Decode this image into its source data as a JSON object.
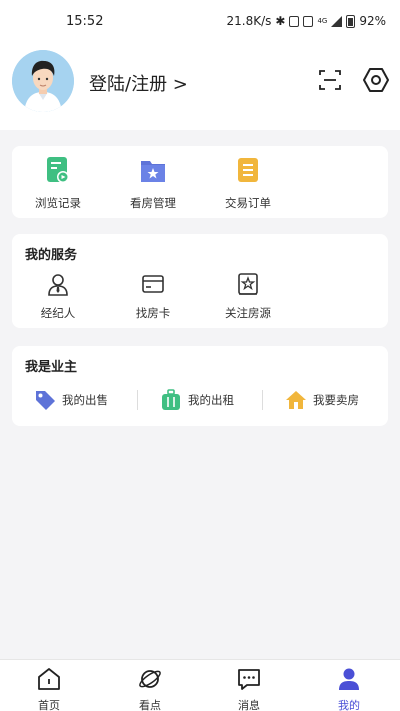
{
  "status_bar": {
    "time": "15:52",
    "network_speed": "21.8K/s",
    "battery": "92%",
    "icons": [
      "bluetooth-icon",
      "vibrate-icon",
      "nfc-icon",
      "4g-icon",
      "signal-icon",
      "battery-icon"
    ]
  },
  "header": {
    "login_label": "登陆/注册 >",
    "icons": [
      "scan-icon",
      "settings-icon"
    ]
  },
  "quick_actions": [
    {
      "label": "浏览记录",
      "icon": "browse-history-icon",
      "color": "#3fbf82"
    },
    {
      "label": "看房管理",
      "icon": "folder-star-icon",
      "color": "#5e73d8"
    },
    {
      "label": "交易订单",
      "icon": "order-list-icon",
      "color": "#f1b63c"
    }
  ],
  "services": {
    "title": "我的服务",
    "items": [
      {
        "label": "经纪人",
        "icon": "agent-icon"
      },
      {
        "label": "找房卡",
        "icon": "card-icon"
      },
      {
        "label": "关注房源",
        "icon": "follow-house-icon"
      }
    ]
  },
  "owner": {
    "title": "我是业主",
    "items": [
      {
        "label": "我的出售",
        "icon": "tag-icon",
        "color": "#5e73d8"
      },
      {
        "label": "我的出租",
        "icon": "luggage-icon",
        "color": "#3fbf82"
      },
      {
        "label": "我要卖房",
        "icon": "house-icon",
        "color": "#f1b63c"
      }
    ]
  },
  "tabbar": {
    "active_color": "#4a4fd6",
    "tabs": [
      {
        "label": "首页",
        "icon": "home-icon"
      },
      {
        "label": "看点",
        "icon": "planet-icon"
      },
      {
        "label": "消息",
        "icon": "message-icon"
      },
      {
        "label": "我的",
        "icon": "profile-icon",
        "active": true
      }
    ]
  }
}
